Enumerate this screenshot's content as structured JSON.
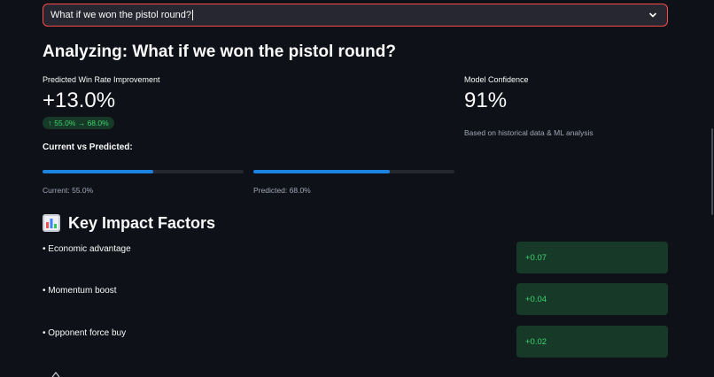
{
  "question_select": {
    "value": "What if we won the pistol round?"
  },
  "heading": "Analyzing: What if we won the pistol round?",
  "win_rate": {
    "label": "Predicted Win Rate Improvement",
    "value": "+13.0%",
    "delta": "55.0% → 68.0%",
    "delta_arrow": "↑"
  },
  "confidence": {
    "label": "Model Confidence",
    "value": "91%",
    "caption": "Based on historical data & ML analysis"
  },
  "comparison": {
    "title": "Current vs Predicted:",
    "current": {
      "label": "Current: 55.0%",
      "progress": 0.55
    },
    "predicted": {
      "label": "Predicted: 68.0%",
      "progress": 0.68
    }
  },
  "factors": {
    "title": "Key Impact Factors",
    "icon": "bar-chart-icon",
    "items": [
      {
        "label": "• Economic advantage",
        "value": "+0.07"
      },
      {
        "label": "• Momentum boost",
        "value": "+0.04"
      },
      {
        "label": "• Opponent force buy",
        "value": "+0.02"
      }
    ]
  },
  "colors": {
    "accent": "#ff4b4b",
    "progress": "#1c83e1",
    "positive": "#3dd56d",
    "positive_bg": "#173928",
    "background": "#0e1117"
  }
}
